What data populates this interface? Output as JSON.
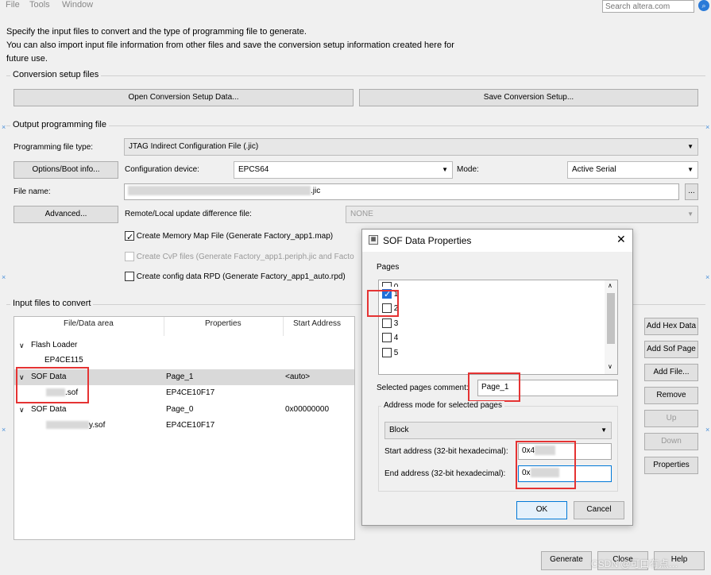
{
  "menu": [
    "File",
    "Tools",
    "Window"
  ],
  "search": {
    "placeholder": "Search altera.com"
  },
  "intro": {
    "line1": "Specify the input files to convert and the type of programming file to generate.",
    "line2": "You can also import input file information from other files and save the conversion setup information created here for",
    "line3": "future use."
  },
  "conversion": {
    "title": "Conversion setup files",
    "open_label": "Open Conversion Setup Data...",
    "save_label": "Save Conversion Setup..."
  },
  "output": {
    "title": "Output programming file",
    "type_label": "Programming file type:",
    "type_value": "JTAG Indirect Configuration File (.jic)",
    "options_label": "Options/Boot info...",
    "config_device_label": "Configuration device:",
    "config_device_value": "EPCS64",
    "mode_label": "Mode:",
    "mode_value": "Active Serial",
    "file_name_label": "File name:",
    "file_name_suffix": ".jic",
    "browse_label": "...",
    "advanced_label": "Advanced...",
    "remote_label": "Remote/Local update difference file:",
    "remote_value": "NONE",
    "opt1": "Create Memory Map File (Generate Factory_app1.map)",
    "opt2": "Create CvP files (Generate Factory_app1.periph.jic and Facto",
    "opt3": "Create config data RPD (Generate Factory_app1_auto.rpd)"
  },
  "input": {
    "title": "Input files to convert",
    "headers": [
      "File/Data area",
      "Properties",
      "Start Address"
    ],
    "rows": [
      {
        "name": "Flash Loader",
        "props": "",
        "addr": ""
      },
      {
        "name": "EP4CE115",
        "props": "",
        "addr": ""
      },
      {
        "name": "SOF Data",
        "props": "Page_1",
        "addr": "<auto>"
      },
      {
        "name": ".sof",
        "props": "EP4CE10F17",
        "addr": ""
      },
      {
        "name": "SOF Data",
        "props": "Page_0",
        "addr": "0x00000000"
      },
      {
        "name": "y.sof",
        "props": "EP4CE10F17",
        "addr": ""
      }
    ]
  },
  "side_buttons": [
    "Add Hex Data",
    "Add Sof Page",
    "Add File...",
    "Remove",
    "Up",
    "Down",
    "Properties"
  ],
  "footer": {
    "generate": "Generate",
    "close": "Close",
    "help": "Help"
  },
  "watermark": "CSDN @可口有点…",
  "dialog": {
    "title": "SOF Data Properties",
    "pages_label": "Pages",
    "pages": [
      "0",
      "1",
      "2",
      "3",
      "4",
      "5"
    ],
    "comment_label": "Selected pages comment:",
    "comment_value": "Page_1",
    "addr_mode_label": "Address mode for selected pages",
    "addr_mode_value": "Block",
    "start_label": "Start address (32-bit hexadecimal):",
    "start_value": "0x4",
    "end_label": "End address (32-bit hexadecimal):",
    "end_value": "0x",
    "ok": "OK",
    "cancel": "Cancel"
  }
}
